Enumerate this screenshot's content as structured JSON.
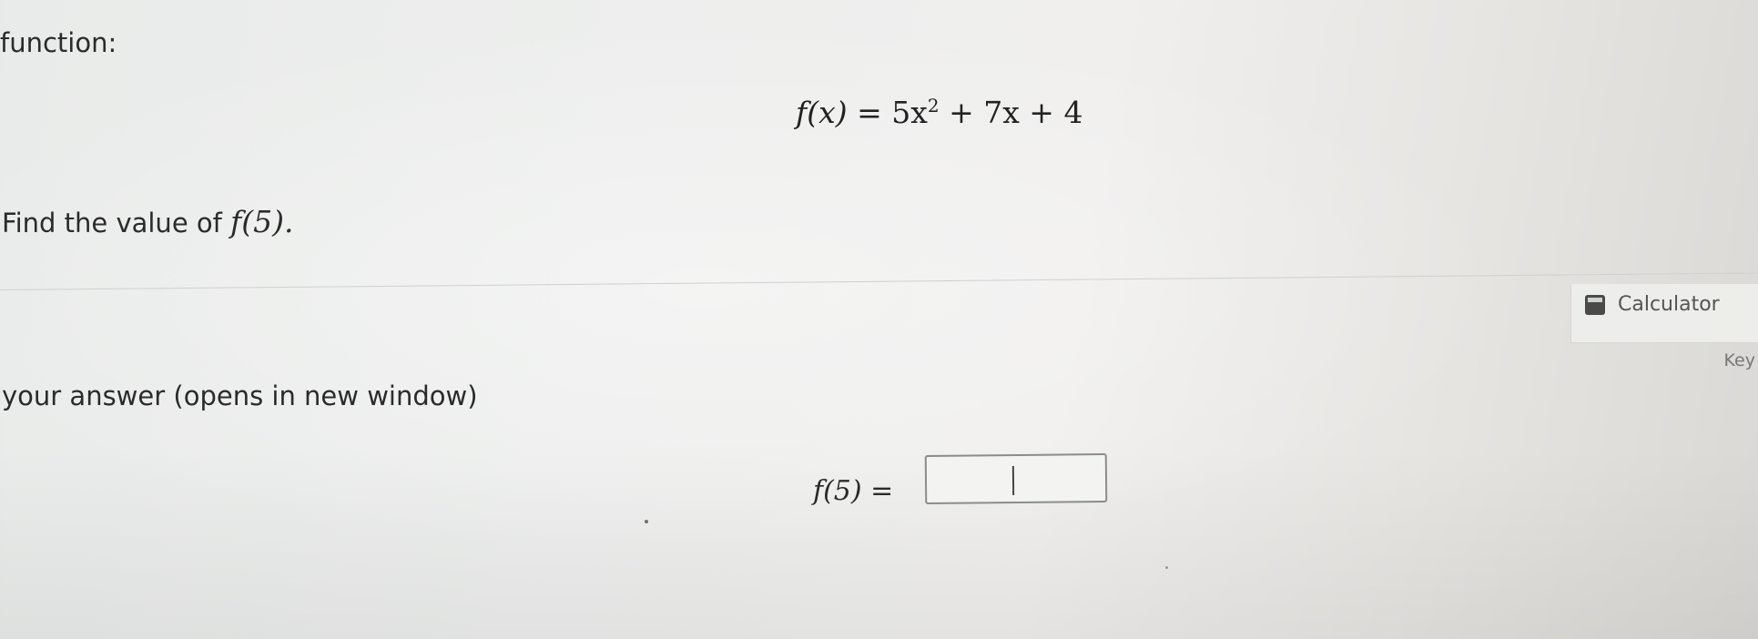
{
  "question": {
    "intro": "function:",
    "equation": {
      "lhs": "f(x)",
      "rhs_first": "= 5x",
      "exponent": "2",
      "rhs_rest": "+ 7x + 4"
    },
    "prompt_text": "Find the value of",
    "prompt_math": "f(5)."
  },
  "tools": {
    "calculator_label": "Calculator",
    "key_label": "Key"
  },
  "answer": {
    "instructions": "your answer (opens in new window)",
    "label": "f(5) =",
    "value": ""
  },
  "colors": {
    "text": "#2b2b2b",
    "input_border": "#8a8d8a",
    "calculator_icon": "#4a4a4a"
  },
  "icons": {
    "calculator": "calculator-icon"
  }
}
